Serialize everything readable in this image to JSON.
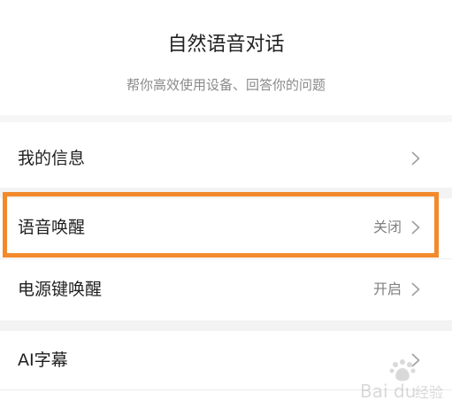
{
  "header": {
    "title": "自然语音对话",
    "subtitle": "帮你高效使用设备、回答你的问题"
  },
  "settings": {
    "items": [
      {
        "label": "我的信息",
        "value": ""
      },
      {
        "label": "语音唤醒",
        "value": "关闭"
      },
      {
        "label": "电源键唤醒",
        "value": "开启"
      },
      {
        "label": "AI字幕",
        "value": ""
      }
    ]
  },
  "highlight": {
    "color": "#f28a2c"
  },
  "watermark": {
    "text": "Bai du 经验"
  }
}
